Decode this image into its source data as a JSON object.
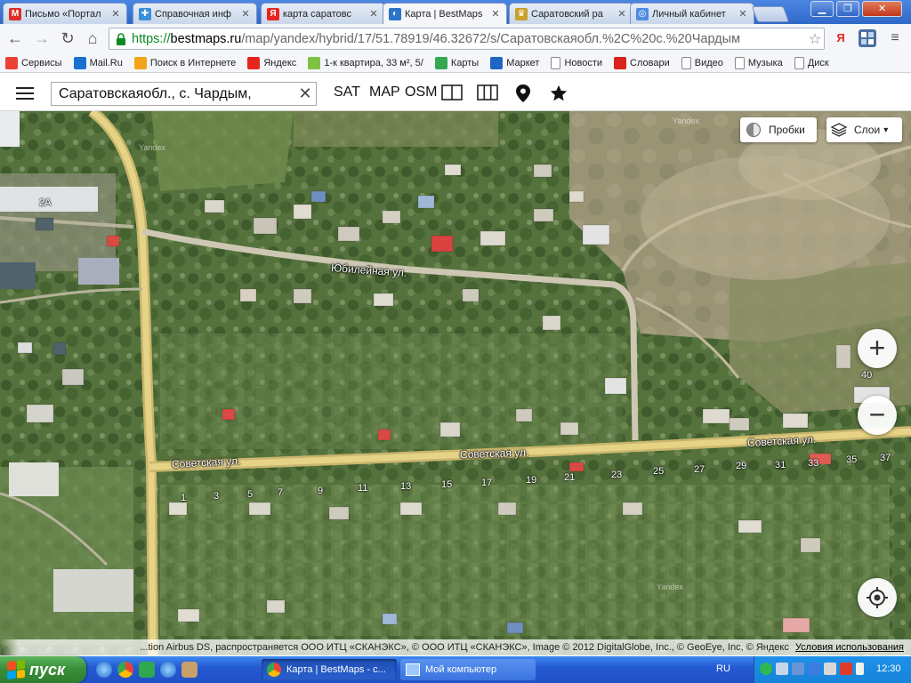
{
  "browser": {
    "tabs": [
      {
        "label": "Письмо «Портал",
        "icon": "gmail-icon",
        "color": "#d93025",
        "glyph": "M"
      },
      {
        "label": "Справочная инф",
        "icon": "puzzle-icon",
        "color": "#3a8fd8",
        "glyph": "✚"
      },
      {
        "label": "карта саратовс",
        "icon": "yandex-icon",
        "color": "#e8241c",
        "glyph": "Я"
      },
      {
        "label": "Карта | BestMaps",
        "icon": "bestmaps-icon",
        "color": "#2b74c9",
        "glyph": "◐"
      },
      {
        "label": "Саратовский ра",
        "icon": "emblem-icon",
        "color": "#c8a02a",
        "glyph": "♛"
      },
      {
        "label": "Личный кабинет",
        "icon": "cabinet-icon",
        "color": "#4d8de0",
        "glyph": "◎"
      }
    ],
    "active_tab": 3,
    "url": {
      "scheme": "https://",
      "host": "bestmaps.ru",
      "path": "/map/yandex/hybrid/17/51.78919/46.32672/s/Саратовскаяобл.%2C%20с.%20Чардым"
    },
    "extension": {
      "yandex": "Я"
    },
    "bookmarks": [
      {
        "label": "Сервисы",
        "icon": "apps-icon",
        "color": "#ea4335"
      },
      {
        "label": "Mail.Ru",
        "icon": "mailru-icon",
        "color": "#1a6fd1"
      },
      {
        "label": "Поиск в Интернете",
        "icon": "search-bm-icon",
        "color": "#f2a419"
      },
      {
        "label": "Яндекс",
        "icon": "yandex-bm-icon",
        "color": "#e8241c"
      },
      {
        "label": "1-к квартира, 33 м², 5/",
        "icon": "avito-icon",
        "color": "#7ec242"
      },
      {
        "label": "Карты",
        "icon": "maps-bm-icon",
        "color": "#34a853"
      },
      {
        "label": "Маркет",
        "icon": "market-icon",
        "color": "#1f66c4"
      },
      {
        "label": "Новости",
        "icon": "page-icon",
        "color": "#ffffff"
      },
      {
        "label": "Словари",
        "icon": "dict-icon",
        "color": "#d8261c"
      },
      {
        "label": "Видео",
        "icon": "page-icon",
        "color": "#ffffff"
      },
      {
        "label": "Музыка",
        "icon": "page-icon",
        "color": "#ffffff"
      },
      {
        "label": "Диск",
        "icon": "page-icon",
        "color": "#ffffff"
      }
    ]
  },
  "app": {
    "search_value": "Саратовскаяобл., с. Чардым,",
    "modes": {
      "sat": "SAT",
      "map": "MAP",
      "osm": "OSM"
    },
    "traffic_label": "Пробки",
    "layers_label": "Слои",
    "zoom_in": "+",
    "zoom_out": "−"
  },
  "map": {
    "streets": {
      "yubileynaya": "Юбилейная ул.",
      "sovetskaya": "Советская ул."
    },
    "labels": {
      "block_2a": "2А",
      "house_40": "40"
    },
    "house_numbers": [
      "1",
      "3",
      "5",
      "7",
      "9",
      "11",
      "13",
      "15",
      "17",
      "19",
      "21",
      "23",
      "25",
      "27",
      "29",
      "31",
      "33",
      "35",
      "37"
    ],
    "watermark": "Yandex",
    "attribution": "...tion Airbus DS, распространяется ООО ИТЦ «СКАНЭКС», © ООО ИТЦ «СКАНЭКС», Image © 2012 DigitalGlobe, Inc., © GeoEye, Inc, © Яндекс",
    "attribution_link": "Условия использования"
  },
  "taskbar": {
    "start_label": "пуск",
    "windows": [
      {
        "label": "Карта | BestMaps - с...",
        "icon": "chrome-icon"
      },
      {
        "label": "Мой компьютер",
        "icon": "computer-icon"
      }
    ],
    "language": "RU",
    "clock": "12:30"
  }
}
